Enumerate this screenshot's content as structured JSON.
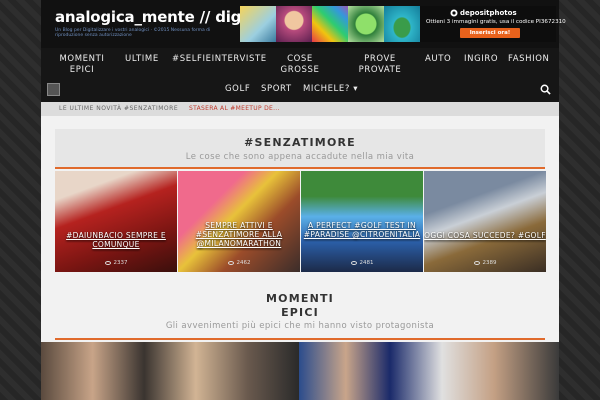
{
  "header": {
    "site_title": "analogica_mente // digitale",
    "tagline": "Un Blog per Digitalizzare i vostri analogici · ©2015 Nessuna forma di riproduzione senza autorizzazione",
    "ad": {
      "brand": "depositphotos",
      "offer": "Ottieni 3 immagini gratis, usa il codice PI3672310",
      "cta": "Inserisci ora!"
    }
  },
  "nav": {
    "row1": [
      "MOMENTI EPICI",
      "ULTIME",
      "#SELFIEINTERVISTE",
      "COSE GROSSE",
      "PROVE PROVATE",
      "AUTO",
      "INGIRO",
      "FASHION"
    ],
    "row2": [
      "GOLF",
      "SPORT",
      "MICHELE? ▾"
    ]
  },
  "ticker": {
    "label": "LE ULTIME NOVITÀ #SENZATIMORE",
    "item": "STASERA AL #MEETUP DE..."
  },
  "section1": {
    "title": "#SENZATIMORE",
    "subtitle": "Le cose che sono appena accadute nella mia vita",
    "cards": [
      {
        "label": "#DAIUNBACIO SEMPRE E COMUNQUE",
        "views": "2337"
      },
      {
        "label": "SEMPRE ATTIVI E #SENZATIMORE ALLA @MILANOMARATHON",
        "views": "2462"
      },
      {
        "label": "A PERFECT #GOLF TEST IN #PARADISE @CITROENITALIA",
        "views": "2481"
      },
      {
        "label": "OGGI COSA SUCCEDE? #GOLF",
        "views": "2389"
      }
    ]
  },
  "section2": {
    "title_line1": "MOMENTI",
    "title_line2": "EPICI",
    "subtitle": "Gli avvenimenti più epici che mi hanno visto protagonista"
  },
  "colors": {
    "accent": "#e06a2c",
    "ticker_red": "#c0392b"
  }
}
